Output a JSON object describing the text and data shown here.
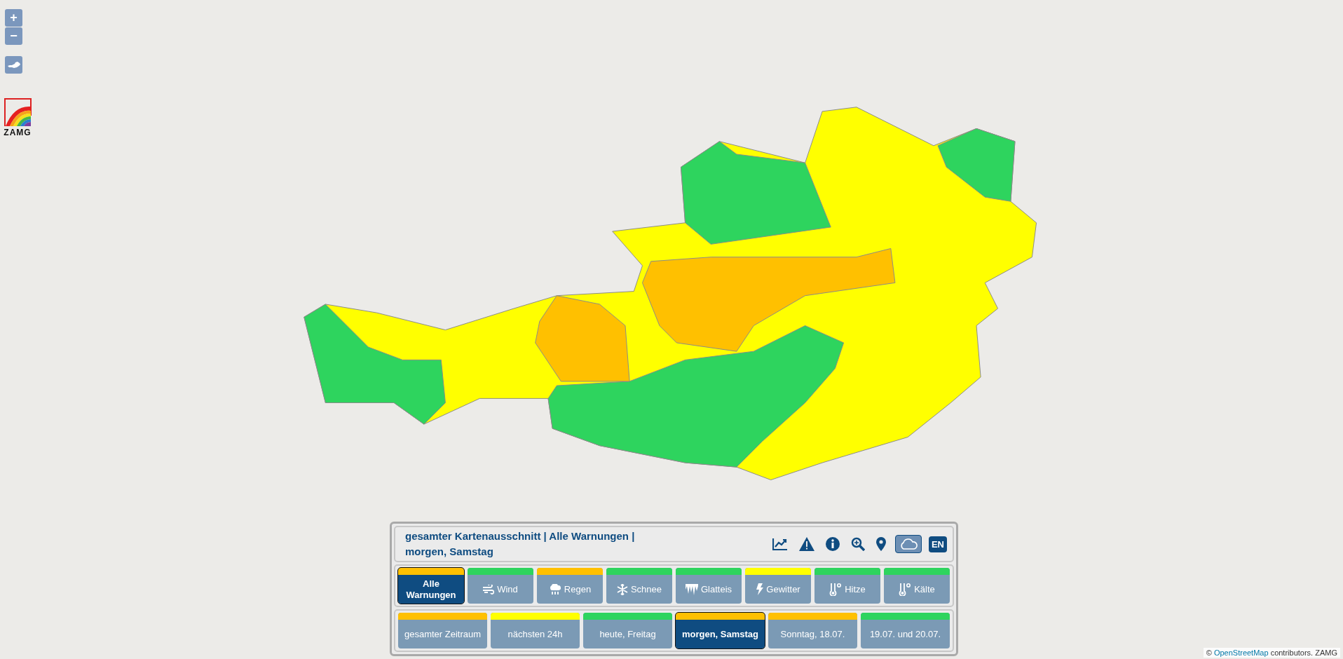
{
  "map": {
    "zoom_in": "+",
    "zoom_out": "−",
    "logo_text": "ZAMG",
    "warning_regions": [
      {
        "color": "#ffff00"
      },
      {
        "color": "#2ed45e"
      },
      {
        "color": "#2ed45e"
      },
      {
        "color": "#2ed45e"
      },
      {
        "color": "#2ed45e"
      },
      {
        "color": "#ffc000"
      },
      {
        "color": "#ffc000"
      }
    ],
    "attribution": {
      "prefix": "©",
      "link": "OpenStreetMap",
      "suffix": "contributors. ZAMG"
    }
  },
  "panel": {
    "title_line_1": "gesamter Kartenausschnitt | Alle Warnungen |",
    "title_line_2": "morgen, Samstag",
    "tools": [
      {
        "kind": "chart",
        "selected": false
      },
      {
        "kind": "warning",
        "selected": false
      },
      {
        "kind": "info",
        "selected": false
      },
      {
        "kind": "zoom",
        "selected": false
      },
      {
        "kind": "pin",
        "selected": false
      },
      {
        "kind": "cloud",
        "selected": true
      }
    ],
    "language": "EN",
    "warning_types": [
      {
        "kind": "all",
        "label": "Alle Warnungen",
        "color": "#ffc000",
        "selected": true
      },
      {
        "kind": "wind",
        "label": "Wind",
        "color": "#2ed45e",
        "selected": false
      },
      {
        "kind": "rain",
        "label": "Regen",
        "color": "#ffc000",
        "selected": false
      },
      {
        "kind": "snow",
        "label": "Schnee",
        "color": "#2ed45e",
        "selected": false
      },
      {
        "kind": "ice",
        "label": "Glatteis",
        "color": "#2ed45e",
        "selected": false
      },
      {
        "kind": "storm",
        "label": "Gewitter",
        "color": "#ffff00",
        "selected": false
      },
      {
        "kind": "heat",
        "label": "Hitze",
        "color": "#2ed45e",
        "selected": false
      },
      {
        "kind": "cold",
        "label": "Kälte",
        "color": "#2ed45e",
        "selected": false
      }
    ],
    "periods": [
      {
        "label": "gesamter Zeitraum",
        "color": "#ffc000",
        "selected": false
      },
      {
        "label": "nächsten 24h",
        "color": "#ffff00",
        "selected": false
      },
      {
        "label": "heute, Freitag",
        "color": "#2ed45e",
        "selected": false
      },
      {
        "label": "morgen, Samstag",
        "color": "#ffc000",
        "selected": true
      },
      {
        "label": "Sonntag, 18.07.",
        "color": "#ffc000",
        "selected": false
      },
      {
        "label": "19.07. und 20.07.",
        "color": "#2ed45e",
        "selected": false
      }
    ]
  }
}
